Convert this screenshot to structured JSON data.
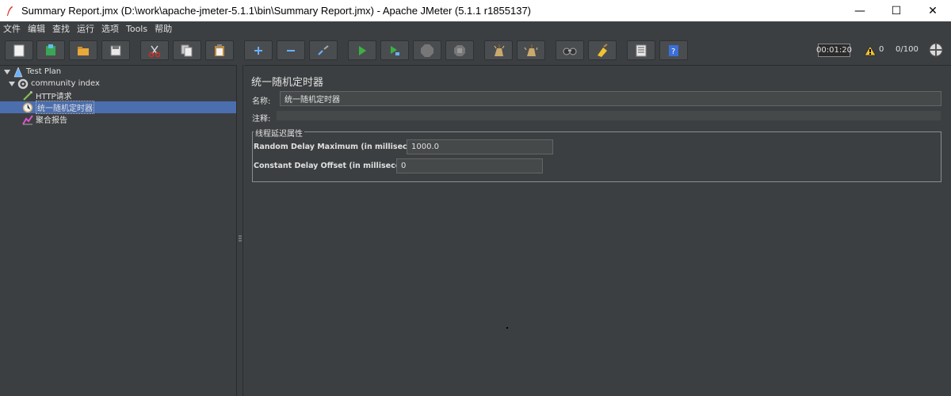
{
  "window": {
    "title": "Summary Report.jmx (D:\\work\\apache-jmeter-5.1.1\\bin\\Summary Report.jmx) - Apache JMeter (5.1.1 r1855137)",
    "minimize": "—",
    "maximize": "☐",
    "close": "✕"
  },
  "menu": [
    {
      "label": "文件"
    },
    {
      "label": "编辑"
    },
    {
      "label": "查找"
    },
    {
      "label": "运行"
    },
    {
      "label": "选项"
    },
    {
      "label": "Tools"
    },
    {
      "label": "帮助"
    }
  ],
  "toolbar": {
    "buttons": [
      "new-icon",
      "templates-icon",
      "open-icon",
      "save-icon",
      "cut-icon",
      "copy-icon",
      "paste-icon",
      "expand-icon",
      "collapse-icon",
      "toggle-icon",
      "start-icon",
      "start-no-pause-icon",
      "stop-icon",
      "shutdown-icon",
      "clear-icon",
      "clear-all-icon",
      "search-icon",
      "reset-search-icon",
      "function-helper-icon",
      "help-icon"
    ],
    "timer": "00:01:20",
    "warning_count": "0",
    "threads": "0/100"
  },
  "tree": {
    "items": [
      {
        "label": "Test Plan",
        "icon": "test-plan-icon"
      },
      {
        "label": "community index",
        "icon": "thread-group-icon"
      },
      {
        "label": "HTTP请求",
        "icon": "http-sampler-icon"
      },
      {
        "label": "统一随机定时器",
        "icon": "timer-icon"
      },
      {
        "label": "聚合报告",
        "icon": "report-icon"
      }
    ],
    "selected_index": 3
  },
  "panel": {
    "title": "统一随机定时器",
    "name_label": "名称:",
    "name_value": "统一随机定时器",
    "comment_label": "注释:",
    "group_title": "线程延迟属性",
    "random_delay_label": "Random Delay Maximum (in milliseconds):",
    "random_delay_value": "1000.0",
    "constant_delay_label": "Constant Delay Offset (in milliseconds):",
    "constant_delay_value": "0"
  },
  "colors": {
    "background": "#3c3f41",
    "selection": "#4b6eaf",
    "field": "#45494a"
  }
}
